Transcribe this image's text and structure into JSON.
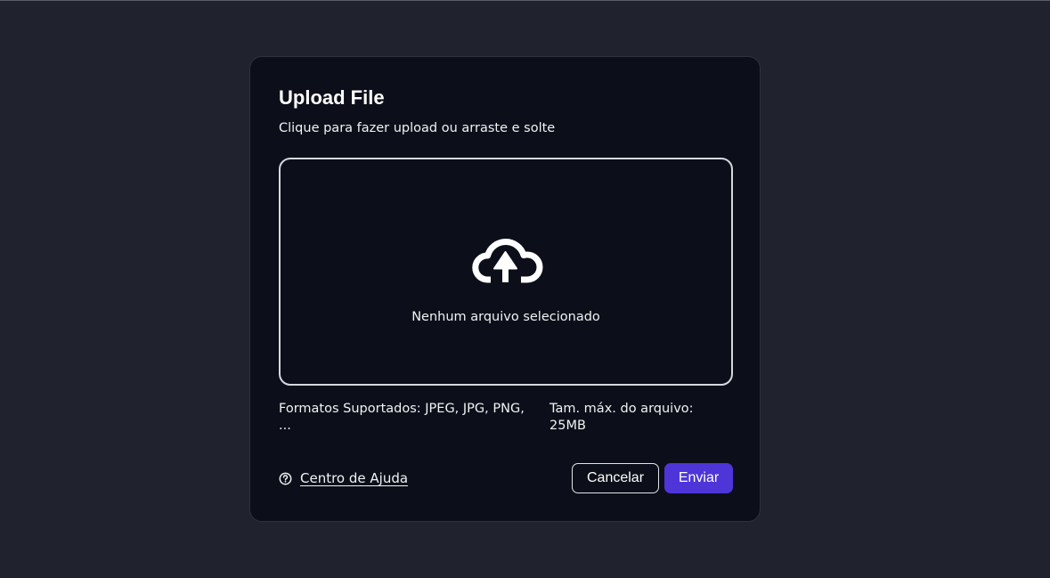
{
  "modal": {
    "title": "Upload File",
    "subtitle": "Clique para fazer upload ou arraste e solte"
  },
  "dropzone": {
    "icon": "cloud-upload-icon",
    "status_text": "Nenhum arquivo selecionado"
  },
  "info": {
    "formats": "Formatos Suportados: JPEG, JPG, PNG, ...",
    "max_size": "Tam. máx. do arquivo: 25MB"
  },
  "footer": {
    "help_icon": "question-circle-icon",
    "help_label": "Centro de Ajuda",
    "cancel_label": "Cancelar",
    "submit_label": "Enviar"
  },
  "colors": {
    "page_background": "#20232d",
    "modal_background": "#0c0f19",
    "accent": "#4d35d8",
    "text": "#f1f2f5"
  }
}
